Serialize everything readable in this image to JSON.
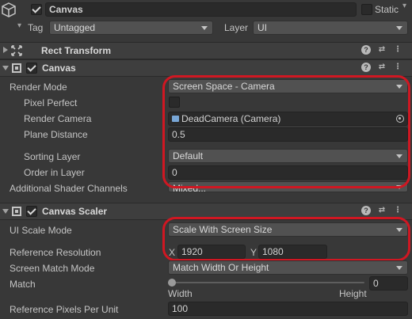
{
  "header": {
    "object_name": "Canvas",
    "static_label": "Static",
    "tag_label": "Tag",
    "tag_value": "Untagged",
    "layer_label": "Layer",
    "layer_value": "UI"
  },
  "rect_transform": {
    "title": "Rect Transform"
  },
  "canvas": {
    "title": "Canvas",
    "render_mode_label": "Render Mode",
    "render_mode_value": "Screen Space - Camera",
    "pixel_perfect_label": "Pixel Perfect",
    "render_camera_label": "Render Camera",
    "render_camera_value": "DeadCamera (Camera)",
    "plane_distance_label": "Plane Distance",
    "plane_distance_value": "0.5",
    "sorting_layer_label": "Sorting Layer",
    "sorting_layer_value": "Default",
    "order_in_layer_label": "Order in Layer",
    "order_in_layer_value": "0",
    "shader_channels_label": "Additional Shader Channels",
    "shader_channels_value": "Mixed..."
  },
  "canvas_scaler": {
    "title": "Canvas Scaler",
    "ui_scale_mode_label": "UI Scale Mode",
    "ui_scale_mode_value": "Scale With Screen Size",
    "reference_resolution_label": "Reference Resolution",
    "x_label": "X",
    "x_value": "1920",
    "y_label": "Y",
    "y_value": "1080",
    "screen_match_mode_label": "Screen Match Mode",
    "screen_match_mode_value": "Match Width Or Height",
    "match_label": "Match",
    "match_value": "0",
    "match_fraction": 0,
    "width_label": "Width",
    "height_label": "Height",
    "ref_pixels_label": "Reference Pixels Per Unit",
    "ref_pixels_value": "100"
  },
  "colors": {
    "highlight": "#d01722",
    "background": "#383838"
  },
  "icons": [
    "gameobject-cube-icon",
    "checkbox-icon",
    "rect-transform-icon",
    "canvas-icon",
    "canvas-scaler-icon",
    "help-icon",
    "presets-icon",
    "more-icon",
    "camera-icon",
    "object-picker-icon"
  ]
}
